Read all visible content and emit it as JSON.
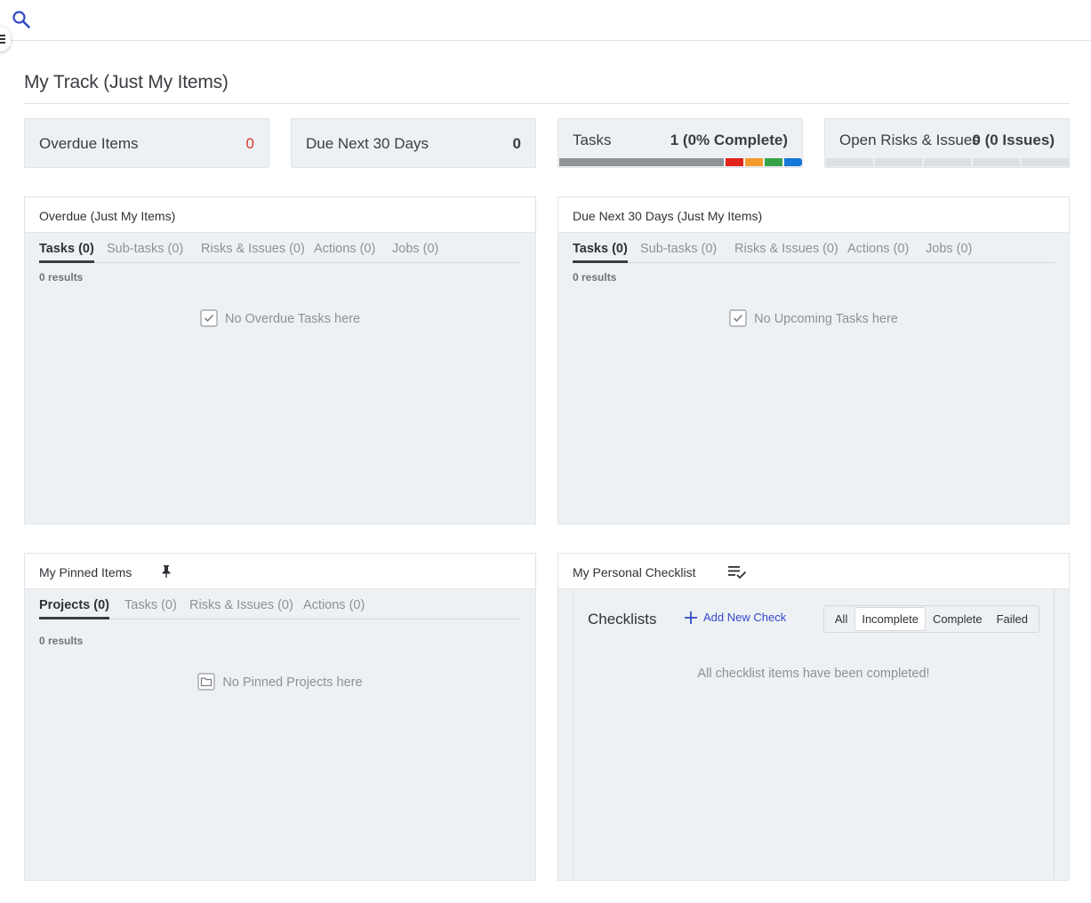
{
  "page_title": "My Track (Just My Items)",
  "stats": {
    "overdue": {
      "label": "Overdue Items",
      "value": "0"
    },
    "due_next": {
      "label": "Due Next 30 Days",
      "value": "0"
    },
    "tasks": {
      "label": "Tasks",
      "value": "1 (0% Complete)",
      "progress_percent": 0
    },
    "risks": {
      "label": "Open Risks & Issues",
      "value": "0 (0 Issues)"
    }
  },
  "colors": {
    "overdue_value": "#d43a2f",
    "accent": "#3449c8",
    "bar_red": "#e1251b",
    "bar_orange": "#f39b2c",
    "bar_green": "#37a349",
    "bar_blue": "#1577d8"
  },
  "overdue_panel": {
    "title": "Overdue (Just My Items)",
    "tabs": [
      "Tasks (0)",
      "Sub-tasks (0)",
      "Risks & Issues (0)",
      "Actions (0)",
      "Jobs (0)"
    ],
    "results": "0 results",
    "empty": "No Overdue Tasks here"
  },
  "due_panel": {
    "title": "Due Next 30 Days (Just My Items)",
    "tabs": [
      "Tasks (0)",
      "Sub-tasks (0)",
      "Risks & Issues (0)",
      "Actions (0)",
      "Jobs (0)"
    ],
    "results": "0 results",
    "empty": "No Upcoming Tasks here"
  },
  "pinned_panel": {
    "title": "My Pinned Items",
    "tabs": [
      "Projects (0)",
      "Tasks (0)",
      "Risks & Issues (0)",
      "Actions (0)"
    ],
    "results": "0 results",
    "empty": "No Pinned Projects here"
  },
  "checklist_panel": {
    "title": "My Personal Checklist",
    "heading": "Checklists",
    "add_label": "Add New Check",
    "filters": [
      "All",
      "Incomplete",
      "Complete",
      "Failed"
    ],
    "active_filter": "Incomplete",
    "empty": "All checklist items have been completed!"
  },
  "icons": {
    "search": "search-icon",
    "menu": "menu-icon",
    "pin": "pin-icon",
    "checklist": "playlist-check-icon",
    "checkbox": "checkbox-icon",
    "folder": "folder-icon",
    "plus": "plus-icon"
  }
}
